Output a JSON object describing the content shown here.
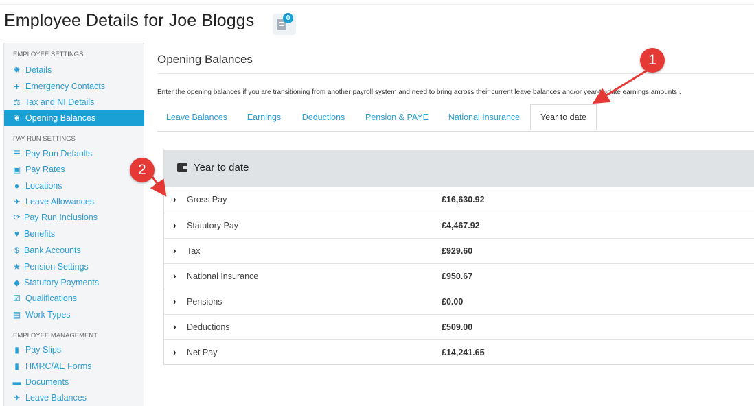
{
  "page": {
    "title": "Employee Details for Joe Bloggs",
    "notes_count": "0"
  },
  "sidebar": {
    "groups": [
      {
        "heading": "EMPLOYEE SETTINGS"
      },
      {
        "heading": "PAY RUN SETTINGS"
      },
      {
        "heading": "EMPLOYEE MANAGEMENT"
      }
    ],
    "items": [
      {
        "label": "Details",
        "icon": "gear-icon"
      },
      {
        "label": "Emergency Contacts",
        "icon": "plus-icon"
      },
      {
        "label": "Tax and NI Details",
        "icon": "scales-icon"
      },
      {
        "label": "Opening Balances",
        "icon": "leaf-icon",
        "active": true
      },
      {
        "label": "Pay Run Defaults",
        "icon": "list-icon"
      },
      {
        "label": "Pay Rates",
        "icon": "money-icon"
      },
      {
        "label": "Locations",
        "icon": "globe-icon"
      },
      {
        "label": "Leave Allowances",
        "icon": "plane-icon"
      },
      {
        "label": "Pay Run Inclusions",
        "icon": "refresh-icon"
      },
      {
        "label": "Benefits",
        "icon": "benefits-icon"
      },
      {
        "label": "Bank Accounts",
        "icon": "dollar-circle-icon"
      },
      {
        "label": "Pension Settings",
        "icon": "star-icon"
      },
      {
        "label": "Statutory Payments",
        "icon": "tag-icon"
      },
      {
        "label": "Qualifications",
        "icon": "checkbox-icon"
      },
      {
        "label": "Work Types",
        "icon": "book-icon"
      },
      {
        "label": "Pay Slips",
        "icon": "file-icon"
      },
      {
        "label": "HMRC/AE Forms",
        "icon": "file-icon"
      },
      {
        "label": "Documents",
        "icon": "folder-icon"
      },
      {
        "label": "Leave Balances",
        "icon": "plane-icon"
      }
    ]
  },
  "main": {
    "section_title": "Opening Balances",
    "intro": "Enter the opening balances if you are transitioning from another payroll system and need to bring across their current leave balances and/or year-to-date earnings amounts .",
    "tabs": [
      {
        "label": "Leave Balances"
      },
      {
        "label": "Earnings"
      },
      {
        "label": "Deductions"
      },
      {
        "label": "Pension & PAYE"
      },
      {
        "label": "National Insurance"
      },
      {
        "label": "Year to date",
        "active": true
      }
    ],
    "panel": {
      "title": "Year to date",
      "rows": [
        {
          "name": "Gross Pay",
          "amount": "£16,630.92"
        },
        {
          "name": "Statutory Pay",
          "amount": "£4,467.92"
        },
        {
          "name": "Tax",
          "amount": "£929.60"
        },
        {
          "name": "National Insurance",
          "amount": "£950.67"
        },
        {
          "name": "Pensions",
          "amount": "£0.00"
        },
        {
          "name": "Deductions",
          "amount": "£509.00"
        },
        {
          "name": "Net Pay",
          "amount": "£14,241.65"
        }
      ]
    }
  },
  "annotations": [
    {
      "label": "1",
      "color": "#e53935"
    },
    {
      "label": "2",
      "color": "#e53935"
    }
  ]
}
